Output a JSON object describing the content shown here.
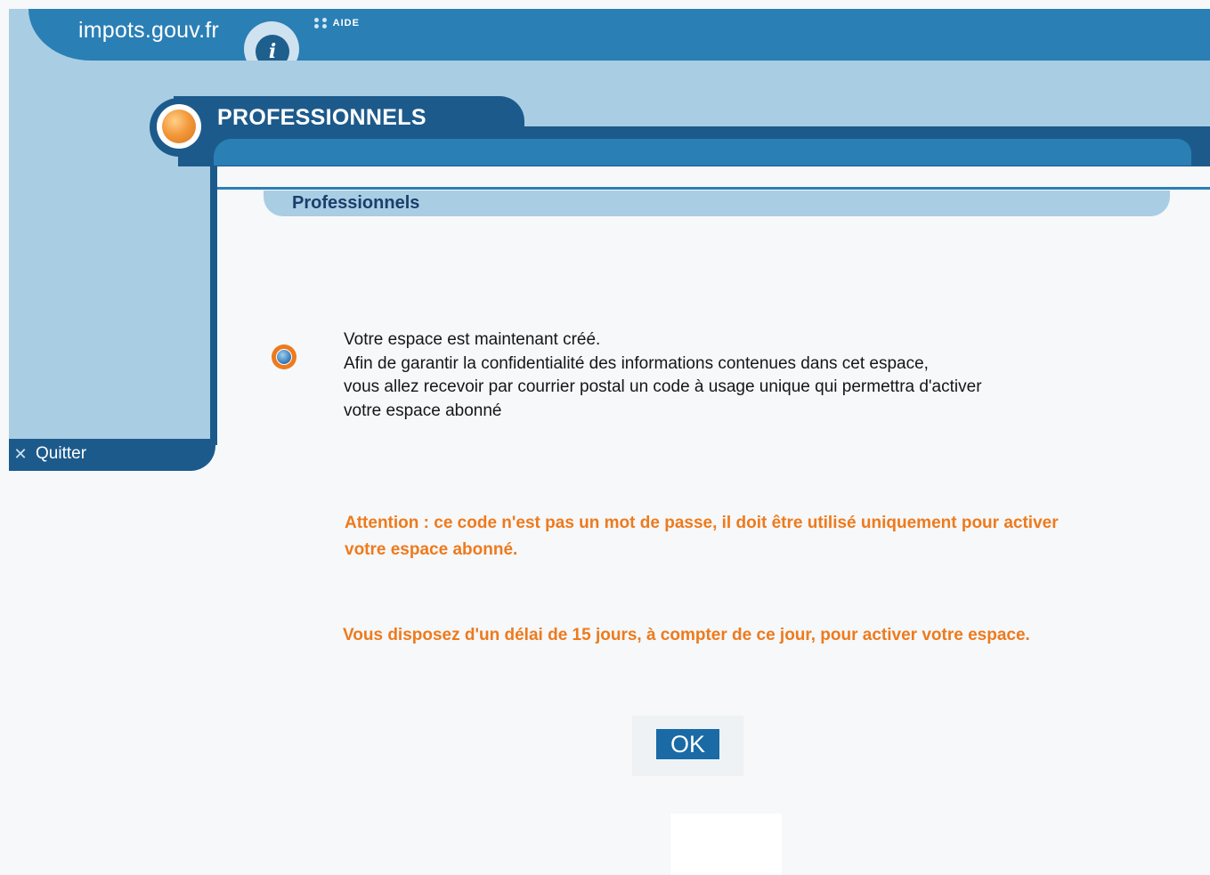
{
  "header": {
    "logo_text": "impots.gouv.fr",
    "info_glyph": "i",
    "help_link": "AIDE"
  },
  "section": {
    "title": "PROFESSIONNELS",
    "subtitle": "Professionnels"
  },
  "sidebar": {
    "quit_label": "Quitter"
  },
  "message": {
    "lines": [
      "Votre espace est maintenant créé.",
      "Afin de garantir la confidentialité des informations contenues dans cet espace,",
      "vous allez recevoir par courrier postal un code à usage unique qui permettra d'activer",
      "votre espace abonné"
    ]
  },
  "warning": {
    "lines": [
      "Attention : ce code n'est pas un mot de passe, il doit être utilisé uniquement pour activer",
      "votre espace abonné."
    ]
  },
  "delay_notice": "Vous disposez d'un délai de  15 jours, à compter de ce jour, pour activer votre espace.",
  "actions": {
    "ok_label": "OK"
  },
  "colors": {
    "primary_blue": "#2a7fb5",
    "dark_blue": "#1d5a8c",
    "light_blue": "#a9cde3",
    "accent_orange": "#ee7a1c"
  },
  "icons": {
    "logo_badge": "info-icon",
    "help": "dots-icon",
    "section": "orange-orb-icon",
    "bullet": "globe-icon",
    "quit": "close-x-icon"
  }
}
